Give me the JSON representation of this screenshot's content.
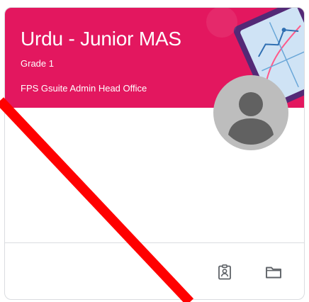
{
  "class_card": {
    "title": "Urdu - Junior MAS",
    "section": "Grade 1",
    "owner": "FPS Gsuite Admin Head Office",
    "header_color": "#e3175f",
    "icons": {
      "avatar": "person-avatar-icon",
      "work": "assignment-ind-icon",
      "folder": "folder-icon"
    }
  },
  "overlay": {
    "mark_color": "#ff0000"
  }
}
